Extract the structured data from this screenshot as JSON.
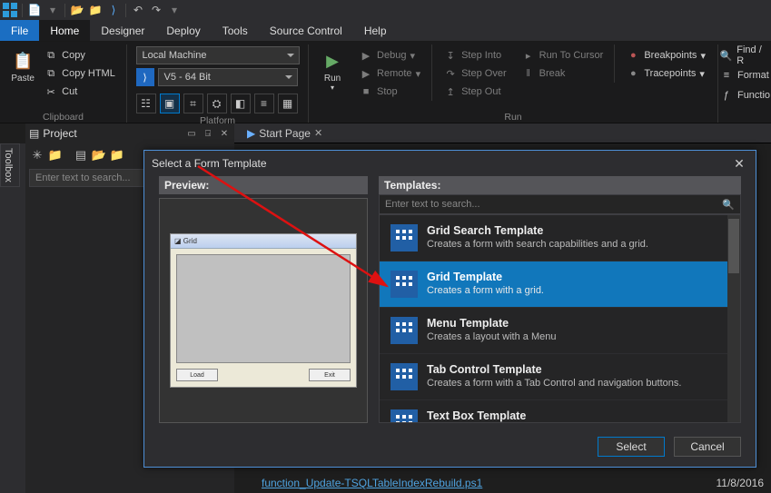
{
  "menu": {
    "file": "File",
    "home": "Home",
    "designer": "Designer",
    "deploy": "Deploy",
    "tools": "Tools",
    "source_ctrl": "Source Control",
    "help": "Help"
  },
  "ribbon": {
    "clipboard": {
      "label": "Clipboard",
      "paste": "Paste",
      "copy": "Copy",
      "copy_html": "Copy HTML",
      "cut": "Cut"
    },
    "platform": {
      "label": "Platform",
      "machine": "Local Machine",
      "version": "V5  -  64 Bit"
    },
    "run": {
      "label": "Run",
      "run": "Run",
      "debug": "Debug",
      "remote": "Remote",
      "stop": "Stop",
      "step_into": "Step Into",
      "step_over": "Step Over",
      "step_out": "Step Out",
      "run_to_cursor": "Run To Cursor",
      "break": "Break",
      "breakpoints": "Breakpoints",
      "tracepoints": "Tracepoints"
    },
    "right": {
      "find": "Find / R",
      "format": "Format",
      "function": "Functio"
    }
  },
  "project_pane": {
    "title": "Project",
    "search_placeholder": "Enter text to search..."
  },
  "start_tab": "Start Page",
  "toolbox": "Toolbox",
  "dialog": {
    "title": "Select a Form Template",
    "preview": "Preview:",
    "templates": "Templates:",
    "search_placeholder": "Enter text to search...",
    "items": [
      {
        "name": "Grid Search Template",
        "desc": "Creates a form with search capabilities and a grid.",
        "selected": false
      },
      {
        "name": "Grid Template",
        "desc": "Creates a form with a grid.",
        "selected": true
      },
      {
        "name": "Menu Template",
        "desc": "Creates a layout with a Menu",
        "selected": false
      },
      {
        "name": "Tab Control Template",
        "desc": "Creates a form with a Tab Control and navigation buttons.",
        "selected": false
      },
      {
        "name": "Text Box Template",
        "desc": "",
        "selected": false
      }
    ],
    "preview_buttons": {
      "left": "Load",
      "right": "Exit"
    },
    "select": "Select",
    "cancel": "Cancel"
  },
  "footer": {
    "link": "function_Update-TSQLTableIndexRebuild.ps1",
    "date": "11/8/2016"
  }
}
